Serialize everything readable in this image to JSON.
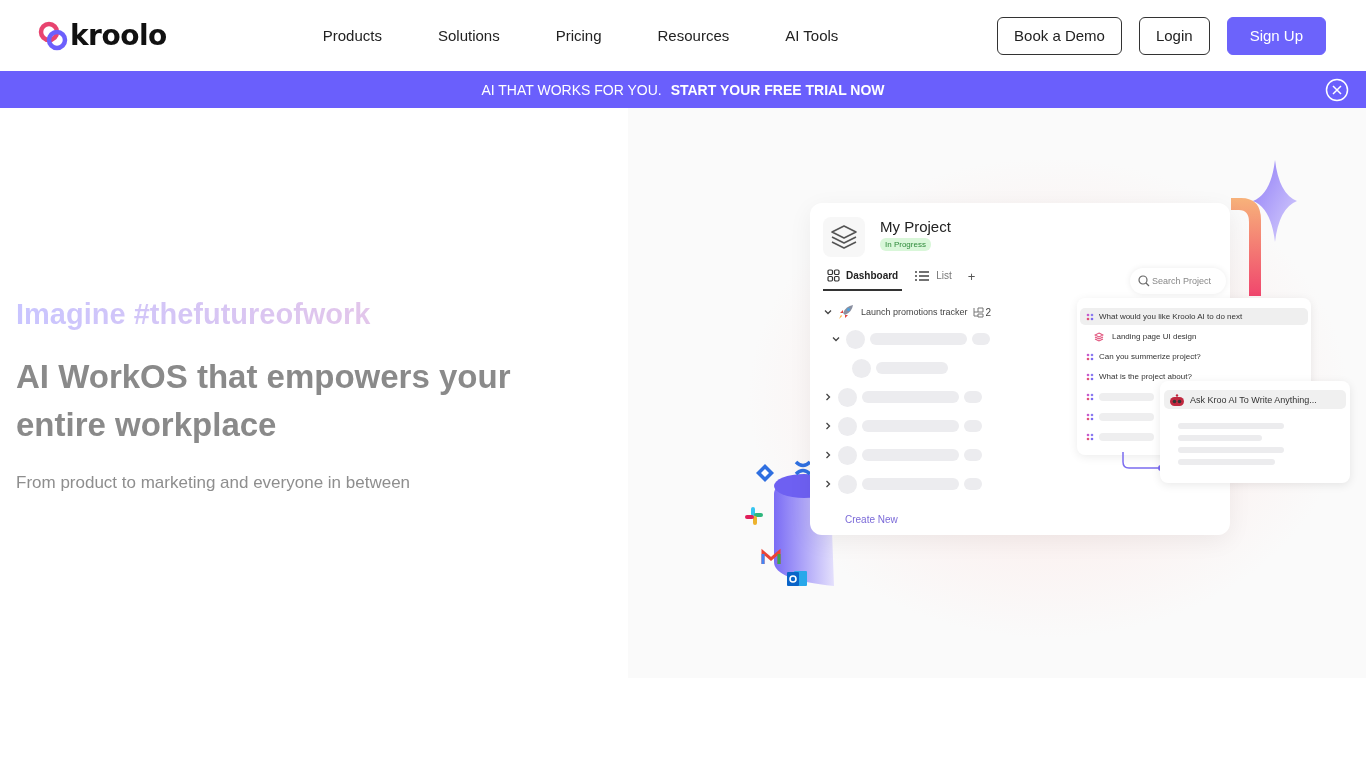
{
  "header": {
    "logo": "kroolo",
    "nav": [
      "Products",
      "Solutions",
      "Pricing",
      "Resources",
      "AI Tools"
    ],
    "buttons": [
      {
        "label": "Book a Demo",
        "kind": "outline"
      },
      {
        "label": "Login",
        "kind": "outline"
      },
      {
        "label": "Sign Up",
        "kind": "primary"
      }
    ]
  },
  "banner": {
    "text": "AI THAT WORKS FOR YOU.",
    "link": "START YOUR FREE TRIAL NOW"
  },
  "hero": {
    "eyebrow": "Imagine #thefutureofwork",
    "title": "AI WorkOS that empowers your entire workplace",
    "subtitle": "From product to marketing and everyone in between"
  },
  "illustration": {
    "project_title": "My Project",
    "status": "In Progress",
    "tabs": [
      {
        "label": "Dashboard",
        "selected": true
      },
      {
        "label": "List",
        "selected": false
      }
    ],
    "add_tab": "+",
    "search": {
      "placeholder": "Search Project"
    },
    "task": {
      "label": "Launch promotions tracker",
      "count": "2",
      "expanded": true
    },
    "skeleton_rows": [
      {
        "expanded": true
      },
      {
        "expanded": false
      },
      {
        "expanded": false
      },
      {
        "expanded": false
      },
      {
        "expanded": false
      }
    ],
    "create_new": "Create New",
    "ai_menu": [
      {
        "kind": "prompt",
        "text": "What would you like Kroolo AI to do next",
        "selected": true
      },
      {
        "kind": "doc",
        "text": "Landing page UI design",
        "selected": false
      },
      {
        "kind": "prompt",
        "text": "Can you summerize project?",
        "selected": false
      },
      {
        "kind": "prompt",
        "text": "What is the project about?",
        "selected": false
      },
      {
        "kind": "skeleton",
        "selected": false
      },
      {
        "kind": "skeleton",
        "selected": false
      },
      {
        "kind": "skeleton",
        "selected": false
      }
    ],
    "ai_prompt": "Ask Kroo AI To Write Anything..."
  }
}
